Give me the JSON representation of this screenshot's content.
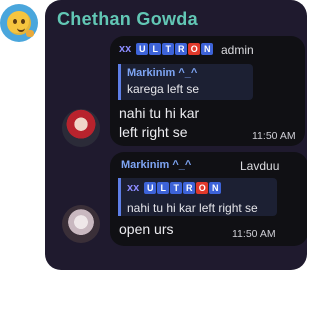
{
  "chat": {
    "title": "Chethan Gowda"
  },
  "messages": [
    {
      "badge_prefix": "xx",
      "badge_letters": [
        "U",
        "L",
        "T",
        "R",
        "O",
        "N"
      ],
      "role": "admin",
      "reply": {
        "name": "Markinim ^_^",
        "text": "karega left se"
      },
      "text_line1": "nahi tu hi kar",
      "text_line2": "left right se",
      "time": "11:50 AM"
    },
    {
      "sender": "Markinim ^_^",
      "role": "Lavduu",
      "reply": {
        "badge_prefix": "xx",
        "badge_letters": [
          "U",
          "L",
          "T",
          "R",
          "O",
          "N"
        ],
        "text": "nahi tu hi kar left right se"
      },
      "text": "open urs",
      "time": "11:50 AM"
    }
  ]
}
